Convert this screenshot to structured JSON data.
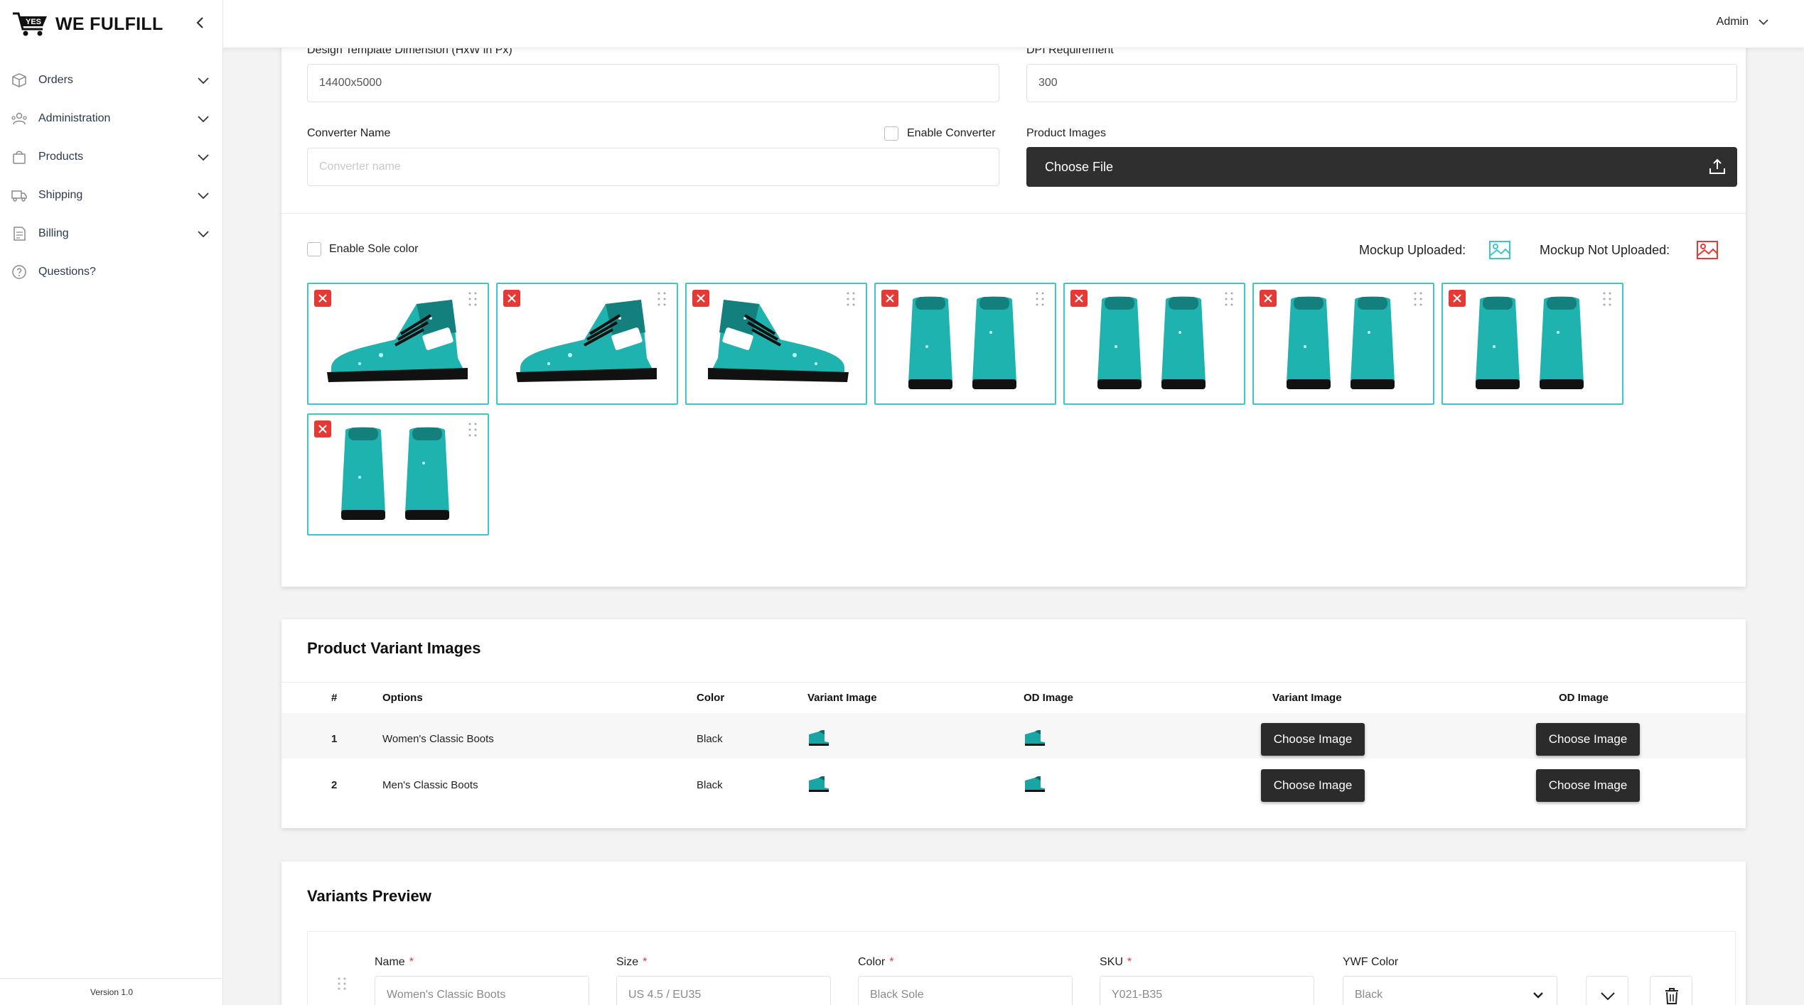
{
  "app": {
    "brand": "WE FULFILL",
    "logo_mark": "YES",
    "version": "Version 1.0",
    "user": "Admin"
  },
  "sidebar": {
    "items": [
      {
        "label": "Orders",
        "icon": "box-icon",
        "expandable": true
      },
      {
        "label": "Administration",
        "icon": "users-icon",
        "expandable": true
      },
      {
        "label": "Products",
        "icon": "bag-icon",
        "expandable": true
      },
      {
        "label": "Shipping",
        "icon": "truck-icon",
        "expandable": true
      },
      {
        "label": "Billing",
        "icon": "invoice-icon",
        "expandable": true
      },
      {
        "label": "Questions?",
        "icon": "question-icon",
        "expandable": false
      }
    ]
  },
  "form": {
    "design_template_label": "Design Template Dimension (HxW in Px)",
    "design_template_value": "14400x5000",
    "dpi_label": "DPI Requirement",
    "dpi_value": "300",
    "converter_name_label": "Converter Name",
    "converter_name_placeholder": "Converter name",
    "enable_converter_label": "Enable Converter",
    "product_images_label": "Product Images",
    "choose_file_label": "Choose File",
    "enable_sole_color_label": "Enable Sole color",
    "mockup_uploaded_label": "Mockup Uploaded:",
    "mockup_not_uploaded_label": "Mockup Not Uploaded:"
  },
  "product_images": [
    {
      "view": "side-right"
    },
    {
      "view": "side-right-heel"
    },
    {
      "view": "side-left"
    },
    {
      "view": "front-pair"
    },
    {
      "view": "back-pair"
    },
    {
      "view": "top-pair"
    },
    {
      "view": "angle-pair"
    },
    {
      "view": "angle-pair-2"
    }
  ],
  "variant_images": {
    "title": "Product Variant Images",
    "columns": [
      "#",
      "Options",
      "Color",
      "Variant Image",
      "OD Image",
      "Variant Image",
      "OD Image"
    ],
    "rows": [
      {
        "num": "1",
        "option": "Women's Classic Boots",
        "color": "Black",
        "variant_btn": "Choose Image",
        "od_btn": "Choose Image"
      },
      {
        "num": "2",
        "option": "Men's Classic Boots",
        "color": "Black",
        "variant_btn": "Choose Image",
        "od_btn": "Choose Image"
      }
    ]
  },
  "variants_preview": {
    "title": "Variants Preview",
    "fields": {
      "name_label": "Name",
      "name_value": "Women's Classic Boots",
      "size_label": "Size",
      "size_value": "US 4.5 / EU35",
      "color_label": "Color",
      "color_value": "Black Sole",
      "sku_label": "SKU",
      "sku_value": "Y021-B35",
      "ywf_color_label": "YWF Color",
      "ywf_color_value": "Black"
    },
    "required_mark": "*"
  },
  "colors": {
    "accent_teal": "#3ec5c5",
    "danger": "#e53935",
    "dark_button": "#2b2b2b"
  }
}
